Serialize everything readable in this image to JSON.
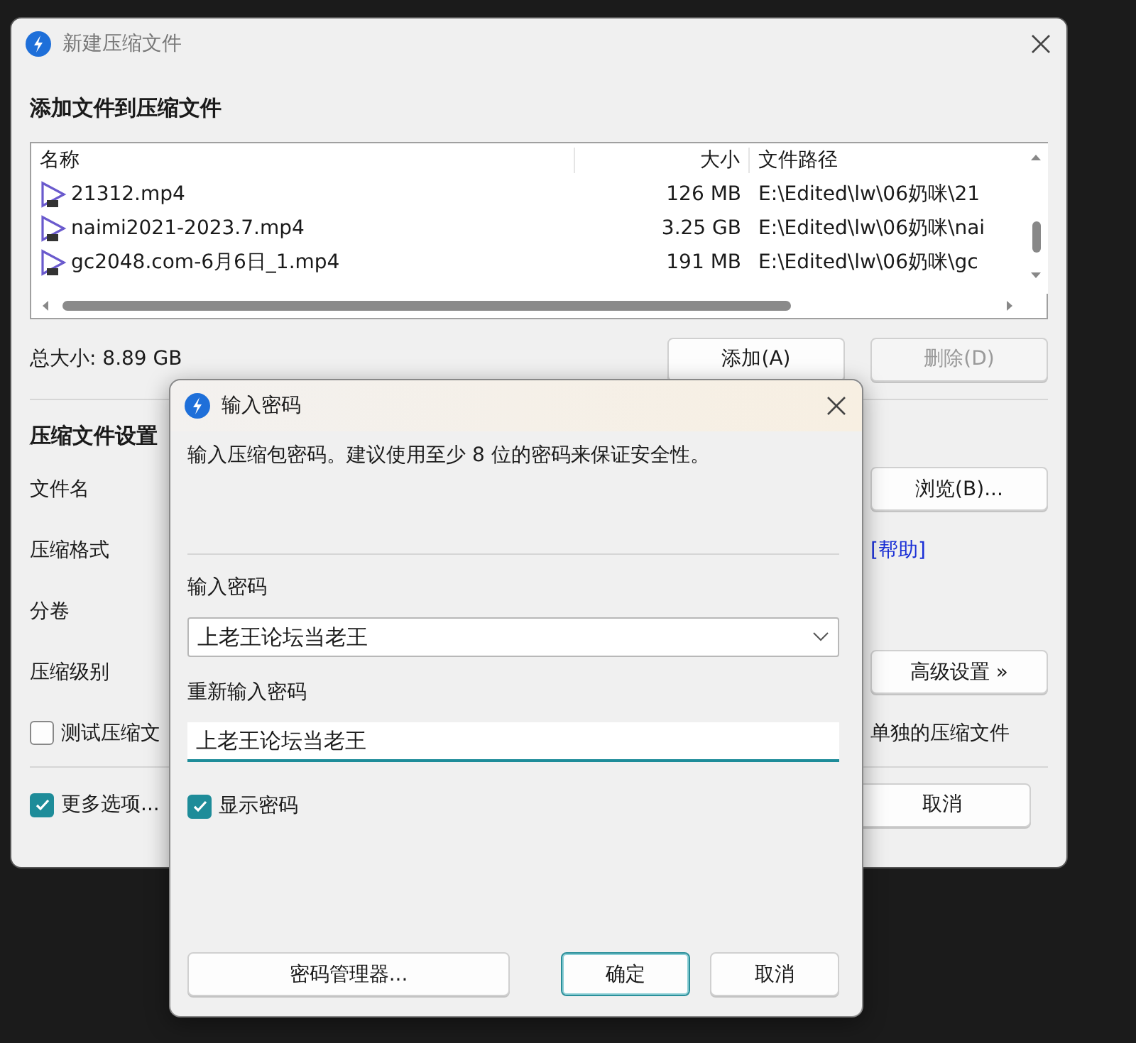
{
  "main_window": {
    "title": "新建压缩文件",
    "heading": "添加文件到压缩文件",
    "file_list": {
      "columns": [
        "名称",
        "大小",
        "文件路径"
      ],
      "rows": [
        {
          "name": "21312.mp4",
          "size": "126 MB",
          "path": "E:\\Edited\\lw\\06奶咪\\21"
        },
        {
          "name": "naimi2021-2023.7.mp4",
          "size": "3.25 GB",
          "path": "E:\\Edited\\lw\\06奶咪\\nai"
        },
        {
          "name": "gc2048.com-6月6日_1.mp4",
          "size": "191 MB",
          "path": "E:\\Edited\\lw\\06奶咪\\gc"
        }
      ]
    },
    "total_size": "总大小: 8.89 GB",
    "list_buttons": [
      {
        "label": "添加(A)",
        "disabled": false
      },
      {
        "label": "删除(D)",
        "disabled": true
      }
    ],
    "settings_heading": "压缩文件设置",
    "settings": [
      {
        "label": "文件名",
        "kind": "button",
        "action": "浏览(B)..."
      },
      {
        "label": "压缩格式",
        "kind": "link",
        "action": "[帮助]"
      },
      {
        "label": "分卷",
        "kind": "plain"
      },
      {
        "label": "压缩级别",
        "kind": "button",
        "action": "高级设置 »"
      }
    ],
    "test_option": {
      "label": "测试压缩文",
      "checked": false
    },
    "separate_option_text": "单独的压缩文件",
    "more_options": {
      "label": "更多选项...",
      "checked": true
    },
    "cancel_button": "取消"
  },
  "password_dialog": {
    "title": "输入密码",
    "message": "输入压缩包密码。建议使用至少 8 位的密码来保证安全性。",
    "password_label": "输入密码",
    "password_value": "上老王论坛当老王",
    "confirm_label": "重新输入密码",
    "confirm_value": "上老王论坛当老王",
    "show_password": {
      "label": "显示密码",
      "checked": true
    },
    "buttons": [
      {
        "label": "密码管理器...",
        "default": false
      },
      {
        "label": "确定",
        "default": true
      },
      {
        "label": "取消",
        "default": false
      }
    ]
  }
}
